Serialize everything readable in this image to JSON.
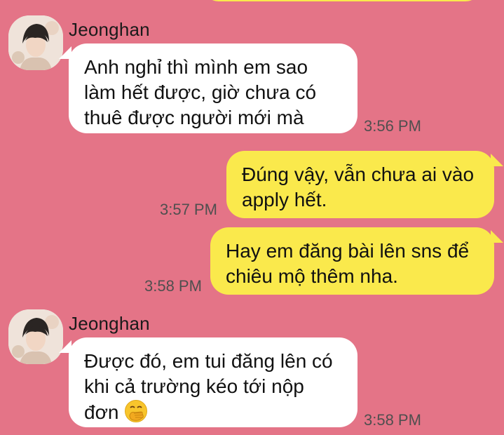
{
  "messages": [
    {
      "direction": "incoming",
      "sender": "Jeonghan",
      "lines": [
        "Anh nghỉ thì mình em sao",
        "làm hết được, giờ chưa có",
        "thuê được người mới mà"
      ],
      "time": "3:56 PM"
    },
    {
      "direction": "outgoing",
      "lines": [
        "Đúng vậy, vẫn chưa ai vào",
        "apply hết."
      ],
      "time": "3:57 PM"
    },
    {
      "direction": "outgoing",
      "lines": [
        "Hay em đăng bài lên sns để",
        "chiêu mộ thêm nha."
      ],
      "time": "3:58 PM"
    },
    {
      "direction": "incoming",
      "sender": "Jeonghan",
      "lines": [
        "Được đó, em tui đăng lên có",
        "khi cả trường kéo tới nộp",
        "đơn"
      ],
      "emoji": "hand-over-mouth-emoji",
      "time": "3:58 PM"
    }
  ],
  "colors": {
    "background": "#e47487",
    "incoming_bubble": "#ffffff",
    "outgoing_bubble": "#fae94c"
  }
}
